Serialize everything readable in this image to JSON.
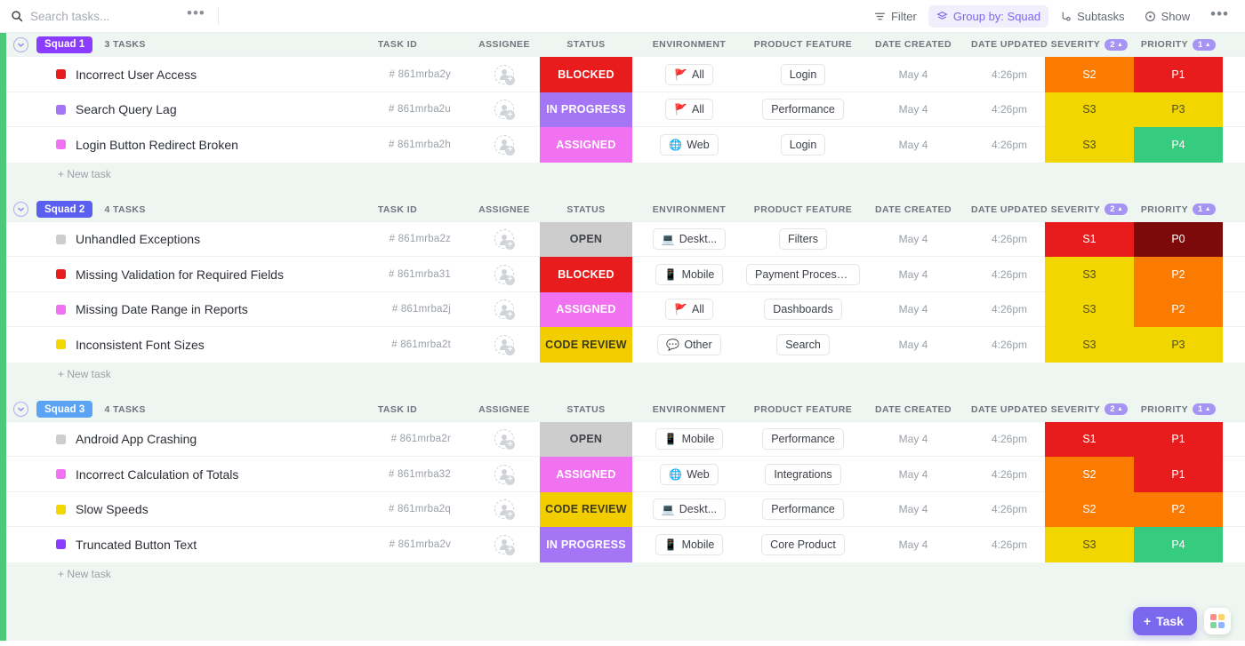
{
  "toolbar": {
    "search_placeholder": "Search tasks...",
    "search_value": "",
    "more_dots": "•••",
    "filter_label": "Filter",
    "group_by_label": "Group by: Squad",
    "subtasks_label": "Subtasks",
    "show_label": "Show",
    "overflow_dots": "•••",
    "accent": "#7b68ee"
  },
  "columns": {
    "task_id": "TASK ID",
    "assignee": "ASSIGNEE",
    "status": "STATUS",
    "environment": "ENVIRONMENT",
    "product_feature": "PRODUCT FEATURE",
    "date_created": "DATE CREATED",
    "date_updated": "DATE UPDATED",
    "severity": "SEVERITY",
    "priority": "PRIORITY",
    "severity_sort_count": "2",
    "priority_sort_count": "1",
    "sort_caret": "▲"
  },
  "new_task_label": "+ New task",
  "status_colors": {
    "BLOCKED": {
      "bg": "#e81c1c",
      "fg": "#ffffff"
    },
    "IN PROGRESS": {
      "bg": "#a476f5",
      "fg": "#ffffff"
    },
    "ASSIGNED": {
      "bg": "#f072f0",
      "fg": "#ffffff"
    },
    "OPEN": {
      "bg": "#cdcdcd",
      "fg": "#404347"
    },
    "CODE REVIEW": {
      "bg": "#f2ce00",
      "fg": "#3d3a17"
    }
  },
  "severity_colors": {
    "S1": {
      "bg": "#e81c1c",
      "fg": "#ffffff"
    },
    "S2": {
      "bg": "#fb7a00",
      "fg": "#ffffff"
    },
    "S3": {
      "bg": "#f2d600",
      "fg": "#55501c"
    }
  },
  "priority_colors": {
    "P0": {
      "bg": "#7d0a0a",
      "fg": "#ffffff"
    },
    "P1": {
      "bg": "#e81c1c",
      "fg": "#ffffff"
    },
    "P2": {
      "bg": "#fb7a00",
      "fg": "#ffffff"
    },
    "P3": {
      "bg": "#f2d600",
      "fg": "#55501c"
    },
    "P4": {
      "bg": "#36cc7f",
      "fg": "#ffffff"
    }
  },
  "env_icons": {
    "All": "🚩",
    "Web": "🌐",
    "Mobile": "📱",
    "Deskt...": "💻",
    "Other": "💬"
  },
  "groups": [
    {
      "name": "Squad 1",
      "color": "#8b3dff",
      "task_count": "3 TASKS",
      "tasks": [
        {
          "dot": "#e81c1c",
          "name": "Incorrect User Access",
          "id": "# 861mrba2y",
          "status": "BLOCKED",
          "env": "All",
          "feature": "Login",
          "created": "May 4",
          "updated": "4:26pm",
          "severity": "S2",
          "priority": "P1"
        },
        {
          "dot": "#a476f5",
          "name": "Search Query Lag",
          "id": "# 861mrba2u",
          "status": "IN PROGRESS",
          "env": "All",
          "feature": "Performance",
          "created": "May 4",
          "updated": "4:26pm",
          "severity": "S3",
          "priority": "P3"
        },
        {
          "dot": "#f072f0",
          "name": "Login Button Redirect Broken",
          "id": "# 861mrba2h",
          "status": "ASSIGNED",
          "env": "Web",
          "feature": "Login",
          "created": "May 4",
          "updated": "4:26pm",
          "severity": "S3",
          "priority": "P4"
        }
      ]
    },
    {
      "name": "Squad 2",
      "color": "#5b5fef",
      "task_count": "4 TASKS",
      "tasks": [
        {
          "dot": "#cdcdcd",
          "name": "Unhandled Exceptions",
          "id": "# 861mrba2z",
          "status": "OPEN",
          "env": "Deskt...",
          "feature": "Filters",
          "created": "May 4",
          "updated": "4:26pm",
          "severity": "S1",
          "priority": "P0"
        },
        {
          "dot": "#e81c1c",
          "name": "Missing Validation for Required Fields",
          "id": "# 861mrba31",
          "status": "BLOCKED",
          "env": "Mobile",
          "feature": "Payment Processi...",
          "created": "May 4",
          "updated": "4:26pm",
          "severity": "S3",
          "priority": "P2"
        },
        {
          "dot": "#f072f0",
          "name": "Missing Date Range in Reports",
          "id": "# 861mrba2j",
          "status": "ASSIGNED",
          "env": "All",
          "feature": "Dashboards",
          "created": "May 4",
          "updated": "4:26pm",
          "severity": "S3",
          "priority": "P2"
        },
        {
          "dot": "#f2d600",
          "name": "Inconsistent Font Sizes",
          "id": "# 861mrba2t",
          "status": "CODE REVIEW",
          "env": "Other",
          "feature": "Search",
          "created": "May 4",
          "updated": "4:26pm",
          "severity": "S3",
          "priority": "P3"
        }
      ]
    },
    {
      "name": "Squad 3",
      "color": "#5ba4f5",
      "task_count": "4 TASKS",
      "tasks": [
        {
          "dot": "#cdcdcd",
          "name": "Android App Crashing",
          "id": "# 861mrba2r",
          "status": "OPEN",
          "env": "Mobile",
          "feature": "Performance",
          "created": "May 4",
          "updated": "4:26pm",
          "severity": "S1",
          "priority": "P1"
        },
        {
          "dot": "#f072f0",
          "name": "Incorrect Calculation of Totals",
          "id": "# 861mrba32",
          "status": "ASSIGNED",
          "env": "Web",
          "feature": "Integrations",
          "created": "May 4",
          "updated": "4:26pm",
          "severity": "S2",
          "priority": "P1"
        },
        {
          "dot": "#f2d600",
          "name": "Slow Speeds",
          "id": "# 861mrba2q",
          "status": "CODE REVIEW",
          "env": "Deskt...",
          "feature": "Performance",
          "created": "May 4",
          "updated": "4:26pm",
          "severity": "S2",
          "priority": "P2"
        },
        {
          "dot": "#8b3dff",
          "name": "Truncated Button Text",
          "id": "# 861mrba2v",
          "status": "IN PROGRESS",
          "env": "Mobile",
          "feature": "Core Product",
          "created": "May 4",
          "updated": "4:26pm",
          "severity": "S3",
          "priority": "P4"
        }
      ]
    }
  ],
  "fab": {
    "task_label": "Task",
    "plus": "+",
    "grid_colors": [
      "#ff8a8a",
      "#ffd36b",
      "#7fd69b",
      "#8fb6ff"
    ]
  }
}
